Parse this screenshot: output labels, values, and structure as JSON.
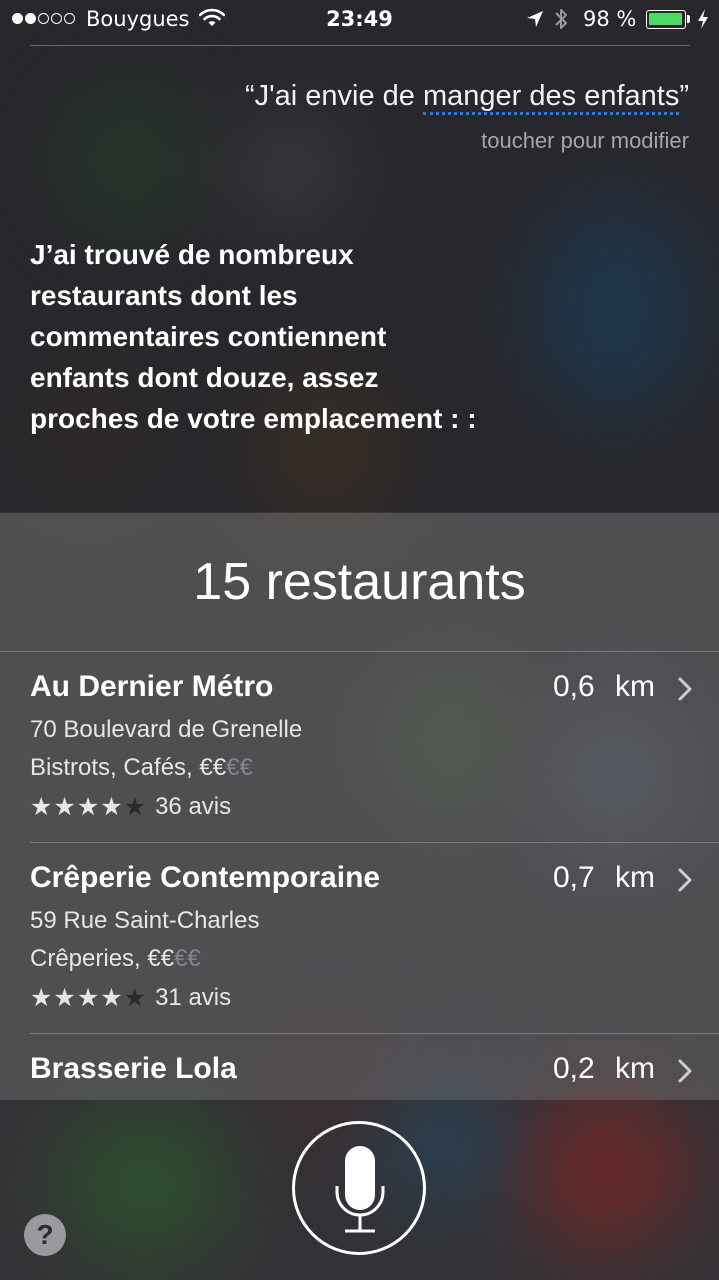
{
  "status_bar": {
    "carrier": "Bouygues",
    "signal_bars_filled": 2,
    "signal_bars_total": 5,
    "time": "23:49",
    "battery_percent": "98 %",
    "battery_level": 0.98,
    "battery_color": "#4cd964",
    "icons": [
      "wifi-icon",
      "location-arrow-icon",
      "bluetooth-icon",
      "battery-icon",
      "charging-bolt-icon"
    ]
  },
  "query": {
    "open_quote": "“",
    "text_plain": "J'ai envie de ",
    "text_underlined": "manger des enfants",
    "close_quote": "”",
    "hint": "toucher pour modifier",
    "underline_color": "#2e7bd6"
  },
  "answer": "J’ai trouvé de nombreux restaurants dont les commentaires contiennent enfants dont douze, assez proches de votre emplacement : :",
  "results": {
    "title": "15 restaurants",
    "items": [
      {
        "name": "Au Dernier Métro",
        "distance": "0,6 km",
        "address": "70 Boulevard de Grenelle",
        "category": "Bistrots, Cafés, ",
        "price_on": "€€",
        "price_off": "€€",
        "rating": 4,
        "stars_on": "★★★★",
        "stars_off": "★",
        "reviews": "36 avis"
      },
      {
        "name": "Crêperie Contemporaine",
        "distance": "0,7 km",
        "address": "59 Rue Saint-Charles",
        "category": "Crêperies, ",
        "price_on": "€€",
        "price_off": "€€",
        "rating": 4,
        "stars_on": "★★★★",
        "stars_off": "★",
        "reviews": "31 avis"
      },
      {
        "name": "Brasserie Lola",
        "distance": "0,2 km"
      }
    ]
  },
  "controls": {
    "mic": "microphone-icon",
    "help_label": "?"
  }
}
